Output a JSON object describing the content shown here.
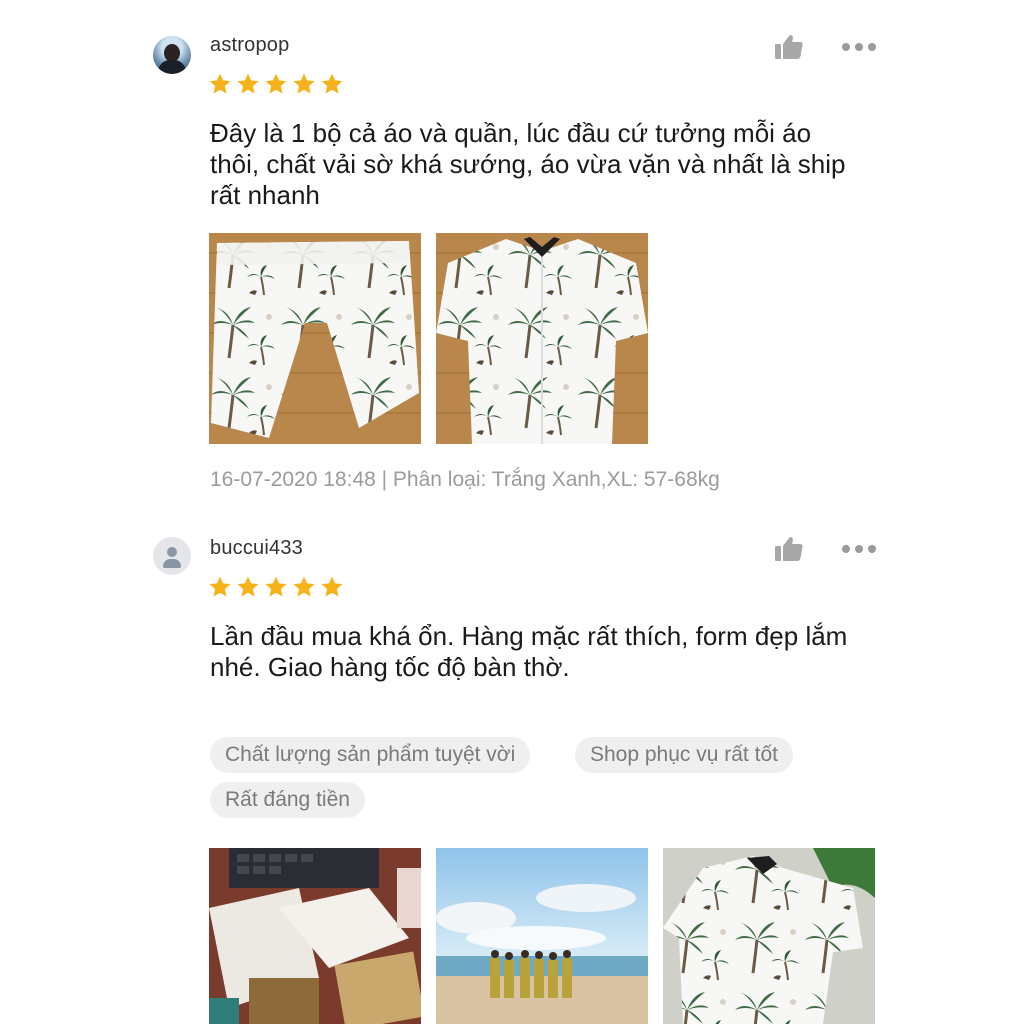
{
  "reviews": [
    {
      "username": "astropop",
      "rating": 5,
      "text_lines": [
        "Đây là 1 bộ cả áo và quần, lúc đầu cứ tưởng mỗi áo",
        "thôi, chất vải sờ khá sướng, áo vừa vặn và nhất là ship",
        "rất nhanh"
      ],
      "meta": "16-07-2020 18:48 | Phân loại: Trắng Xanh,XL: 57-68kg",
      "photos": [
        "palm-print-shorts-photo",
        "palm-print-shirt-photo"
      ]
    },
    {
      "username": "buccui433",
      "rating": 5,
      "text_lines": [
        "Lần đầu mua khá ổn. Hàng mặc rất thích, form đẹp lắm",
        "nhé. Giao hàng tốc độ bàn thờ."
      ],
      "tags": [
        "Chất lượng sản phẩm tuyệt vời",
        "Shop phục vụ rất tốt",
        "Rất đáng tiền"
      ],
      "photos": [
        "packages-photo",
        "beach-group-photo",
        "palm-print-shirt-photo"
      ]
    }
  ],
  "colors": {
    "star": "#f6b21a",
    "tag_bg": "#efefef",
    "meta_text": "#9b9b9b"
  },
  "icons": [
    "thumbs-up-icon",
    "more-options-icon",
    "star-icon",
    "user-placeholder-icon"
  ]
}
